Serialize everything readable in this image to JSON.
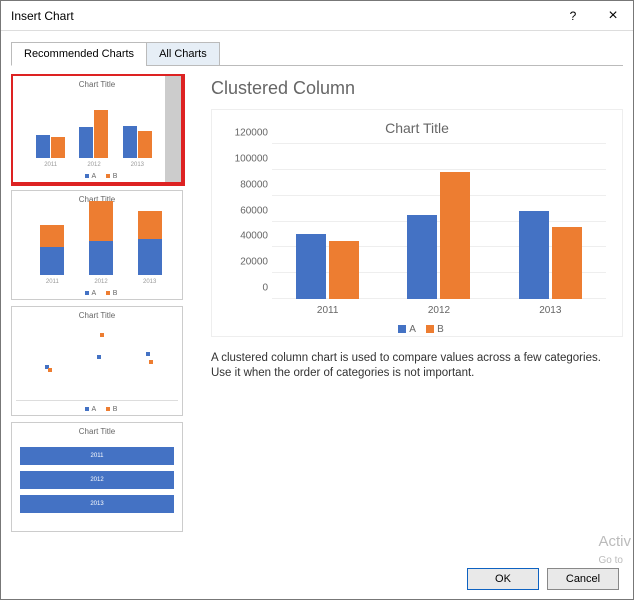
{
  "window": {
    "title": "Insert Chart",
    "help_tooltip": "?",
    "close_tooltip": "×"
  },
  "tabs": {
    "recommended": "Recommended Charts",
    "all": "All Charts"
  },
  "preview": {
    "heading": "Clustered Column",
    "description": "A clustered column chart is used to compare values across a few categories. Use it when the order of categories is not important."
  },
  "buttons": {
    "ok": "OK",
    "cancel": "Cancel"
  },
  "chart_data": {
    "type": "bar",
    "title": "Chart Title",
    "xlabel": "",
    "ylabel": "",
    "ylim": [
      0,
      120000
    ],
    "yticks": [
      0,
      20000,
      40000,
      60000,
      80000,
      100000,
      120000
    ],
    "categories": [
      "2011",
      "2012",
      "2013"
    ],
    "series": [
      {
        "name": "A",
        "values": [
          50000,
          65000,
          68000
        ],
        "color": "#4472C4"
      },
      {
        "name": "B",
        "values": [
          45000,
          98000,
          56000
        ],
        "color": "#ED7D31"
      }
    ]
  },
  "thumbnails": [
    {
      "type": "clustered-column",
      "title": "Chart Title",
      "selected": true
    },
    {
      "type": "stacked-column",
      "title": "Chart Title",
      "selected": false
    },
    {
      "type": "scatter",
      "title": "Chart Title",
      "selected": false
    },
    {
      "type": "bar-list",
      "title": "Chart Title",
      "selected": false
    }
  ],
  "watermark": {
    "line1": "Activ",
    "line2": "Go to"
  }
}
